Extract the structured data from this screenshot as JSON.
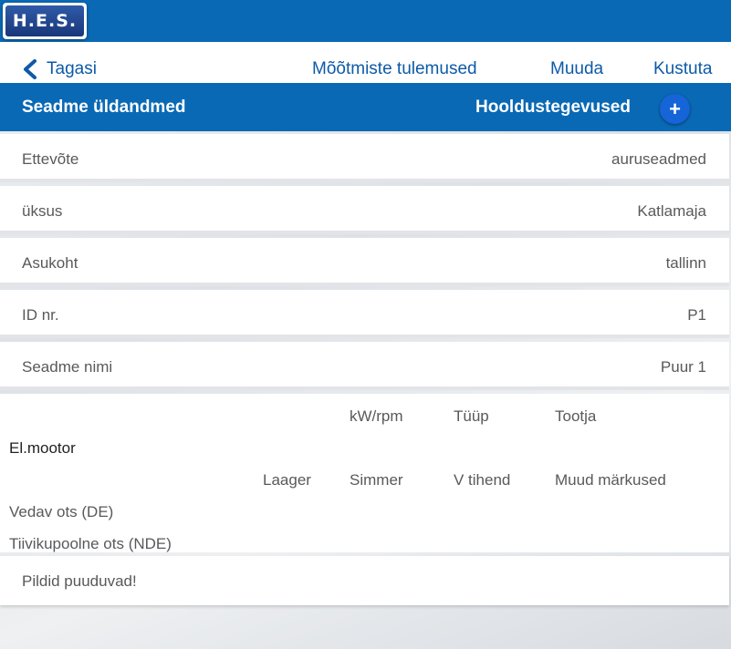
{
  "header": {
    "logo_text": "H.E.S."
  },
  "nav": {
    "back_label": "Tagasi",
    "measurements_label": "Mõõtmiste tulemused",
    "edit_label": "Muuda",
    "delete_label": "Kustuta"
  },
  "section": {
    "title": "Seadme üldandmed",
    "maintenance_label": "Hooldustegevused",
    "add_label": "+"
  },
  "details": [
    {
      "label": "Ettevõte",
      "value": "auruseadmed"
    },
    {
      "label": "üksus",
      "value": "Katlamaja"
    },
    {
      "label": "Asukoht",
      "value": "tallinn"
    },
    {
      "label": "ID nr.",
      "value": "P1"
    },
    {
      "label": "Seadme nimi",
      "value": "Puur 1"
    }
  ],
  "motor": {
    "col_power": "kW/rpm",
    "col_type": "Tüüp",
    "col_maker": "Tootja",
    "title": "El.mootor",
    "col_bearing": "Laager",
    "col_seal": "Simmer",
    "col_vseal": "V tihend",
    "col_notes": "Muud märkused",
    "row_de": "Vedav ots (DE)",
    "row_nde": "Tiivikupoolne ots (NDE)"
  },
  "photos": {
    "empty_text": "Pildid puuduvad!"
  },
  "colors": {
    "primary": "#0a69b4",
    "link": "#0d5aa7",
    "add_button": "#1565d8"
  }
}
